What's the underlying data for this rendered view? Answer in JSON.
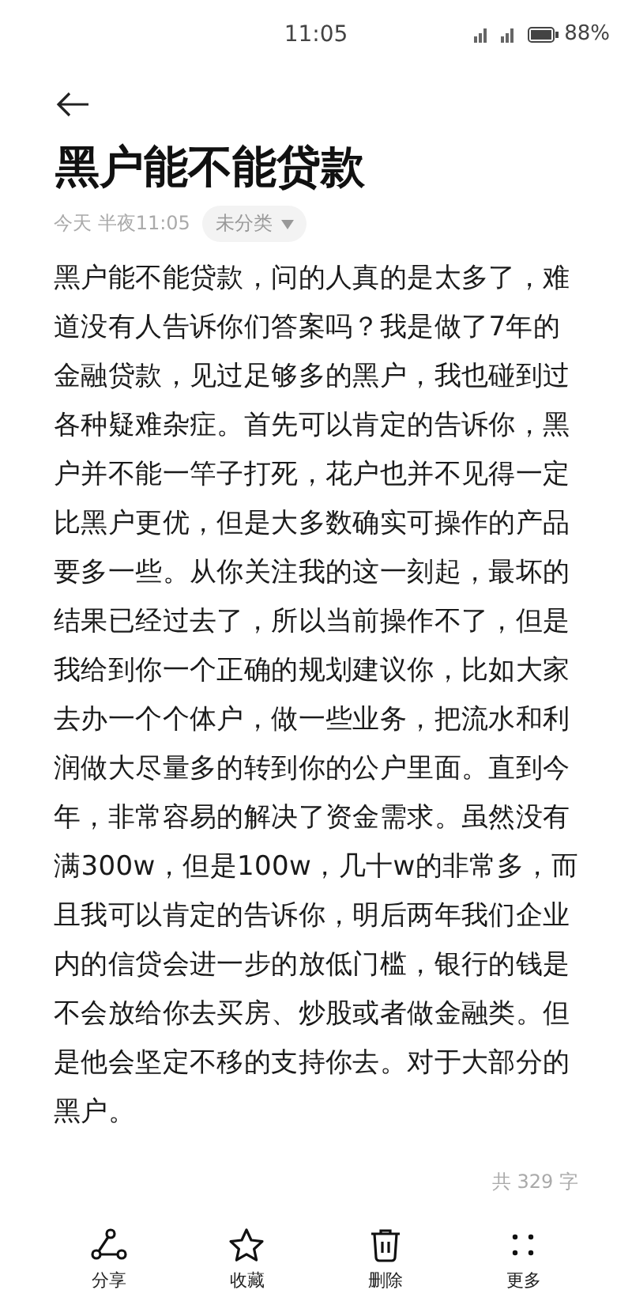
{
  "status_bar": {
    "time": "11:05",
    "battery": "88%"
  },
  "note": {
    "title": "黑户能不能贷款",
    "date": "今天 半夜11:05",
    "category": "未分类",
    "body": "黑户能不能贷款，问的人真的是太多了，难道没有人告诉你们答案吗？我是做了7年的金融贷款，见过足够多的黑户，我也碰到过各种疑难杂症。首先可以肯定的告诉你，黑户并不能一竿子打死，花户也并不见得一定比黑户更优，但是大多数确实可操作的产品要多一些。从你关注我的这一刻起，最坏的结果已经过去了，所以当前操作不了，但是我给到你一个正确的规划建议你，比如大家去办一个个体户，做一些业务，把流水和利润做大尽量多的转到你的公户里面。直到今年，非常容易的解决了资金需求。虽然没有满300w，但是100w，几十w的非常多，而且我可以肯定的告诉你，明后两年我们企业内的信贷会进一步的放低门槛，银行的钱是不会放给你去买房、炒股或者做金融类。但是他会坚定不移的支持你去。对于大部分的黑户。",
    "word_count": "共 329 字"
  },
  "toolbar": [
    {
      "kind": "share",
      "label": "分享"
    },
    {
      "kind": "star",
      "label": "收藏"
    },
    {
      "kind": "delete",
      "label": "删除"
    },
    {
      "kind": "more",
      "label": "更多"
    }
  ]
}
